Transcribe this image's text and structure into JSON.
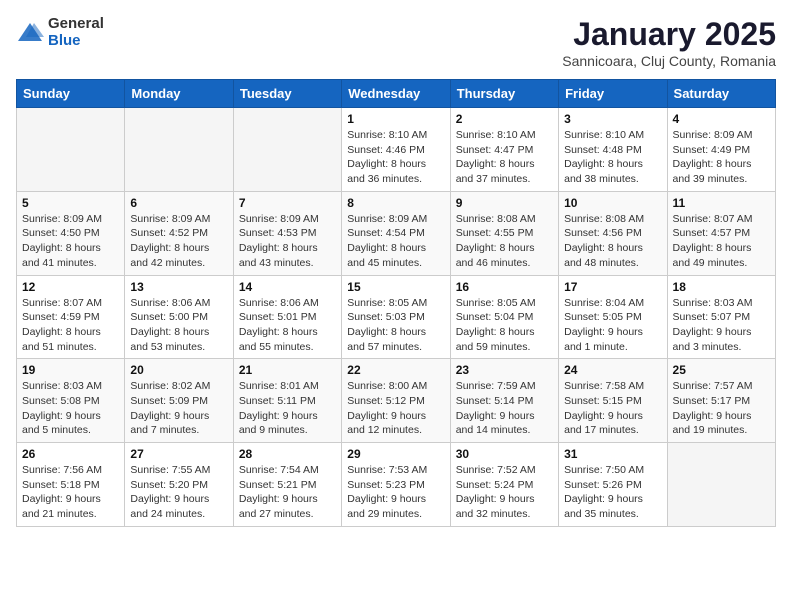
{
  "header": {
    "logo_general": "General",
    "logo_blue": "Blue",
    "title": "January 2025",
    "subtitle": "Sannicoara, Cluj County, Romania"
  },
  "days_of_week": [
    "Sunday",
    "Monday",
    "Tuesday",
    "Wednesday",
    "Thursday",
    "Friday",
    "Saturday"
  ],
  "weeks": [
    [
      {
        "day": "",
        "empty": true
      },
      {
        "day": "",
        "empty": true
      },
      {
        "day": "",
        "empty": true
      },
      {
        "day": "1",
        "sunrise": "8:10 AM",
        "sunset": "4:46 PM",
        "daylight": "8 hours and 36 minutes."
      },
      {
        "day": "2",
        "sunrise": "8:10 AM",
        "sunset": "4:47 PM",
        "daylight": "8 hours and 37 minutes."
      },
      {
        "day": "3",
        "sunrise": "8:10 AM",
        "sunset": "4:48 PM",
        "daylight": "8 hours and 38 minutes."
      },
      {
        "day": "4",
        "sunrise": "8:09 AM",
        "sunset": "4:49 PM",
        "daylight": "8 hours and 39 minutes."
      }
    ],
    [
      {
        "day": "5",
        "sunrise": "8:09 AM",
        "sunset": "4:50 PM",
        "daylight": "8 hours and 41 minutes."
      },
      {
        "day": "6",
        "sunrise": "8:09 AM",
        "sunset": "4:52 PM",
        "daylight": "8 hours and 42 minutes."
      },
      {
        "day": "7",
        "sunrise": "8:09 AM",
        "sunset": "4:53 PM",
        "daylight": "8 hours and 43 minutes."
      },
      {
        "day": "8",
        "sunrise": "8:09 AM",
        "sunset": "4:54 PM",
        "daylight": "8 hours and 45 minutes."
      },
      {
        "day": "9",
        "sunrise": "8:08 AM",
        "sunset": "4:55 PM",
        "daylight": "8 hours and 46 minutes."
      },
      {
        "day": "10",
        "sunrise": "8:08 AM",
        "sunset": "4:56 PM",
        "daylight": "8 hours and 48 minutes."
      },
      {
        "day": "11",
        "sunrise": "8:07 AM",
        "sunset": "4:57 PM",
        "daylight": "8 hours and 49 minutes."
      }
    ],
    [
      {
        "day": "12",
        "sunrise": "8:07 AM",
        "sunset": "4:59 PM",
        "daylight": "8 hours and 51 minutes."
      },
      {
        "day": "13",
        "sunrise": "8:06 AM",
        "sunset": "5:00 PM",
        "daylight": "8 hours and 53 minutes."
      },
      {
        "day": "14",
        "sunrise": "8:06 AM",
        "sunset": "5:01 PM",
        "daylight": "8 hours and 55 minutes."
      },
      {
        "day": "15",
        "sunrise": "8:05 AM",
        "sunset": "5:03 PM",
        "daylight": "8 hours and 57 minutes."
      },
      {
        "day": "16",
        "sunrise": "8:05 AM",
        "sunset": "5:04 PM",
        "daylight": "8 hours and 59 minutes."
      },
      {
        "day": "17",
        "sunrise": "8:04 AM",
        "sunset": "5:05 PM",
        "daylight": "9 hours and 1 minute."
      },
      {
        "day": "18",
        "sunrise": "8:03 AM",
        "sunset": "5:07 PM",
        "daylight": "9 hours and 3 minutes."
      }
    ],
    [
      {
        "day": "19",
        "sunrise": "8:03 AM",
        "sunset": "5:08 PM",
        "daylight": "9 hours and 5 minutes."
      },
      {
        "day": "20",
        "sunrise": "8:02 AM",
        "sunset": "5:09 PM",
        "daylight": "9 hours and 7 minutes."
      },
      {
        "day": "21",
        "sunrise": "8:01 AM",
        "sunset": "5:11 PM",
        "daylight": "9 hours and 9 minutes."
      },
      {
        "day": "22",
        "sunrise": "8:00 AM",
        "sunset": "5:12 PM",
        "daylight": "9 hours and 12 minutes."
      },
      {
        "day": "23",
        "sunrise": "7:59 AM",
        "sunset": "5:14 PM",
        "daylight": "9 hours and 14 minutes."
      },
      {
        "day": "24",
        "sunrise": "7:58 AM",
        "sunset": "5:15 PM",
        "daylight": "9 hours and 17 minutes."
      },
      {
        "day": "25",
        "sunrise": "7:57 AM",
        "sunset": "5:17 PM",
        "daylight": "9 hours and 19 minutes."
      }
    ],
    [
      {
        "day": "26",
        "sunrise": "7:56 AM",
        "sunset": "5:18 PM",
        "daylight": "9 hours and 21 minutes."
      },
      {
        "day": "27",
        "sunrise": "7:55 AM",
        "sunset": "5:20 PM",
        "daylight": "9 hours and 24 minutes."
      },
      {
        "day": "28",
        "sunrise": "7:54 AM",
        "sunset": "5:21 PM",
        "daylight": "9 hours and 27 minutes."
      },
      {
        "day": "29",
        "sunrise": "7:53 AM",
        "sunset": "5:23 PM",
        "daylight": "9 hours and 29 minutes."
      },
      {
        "day": "30",
        "sunrise": "7:52 AM",
        "sunset": "5:24 PM",
        "daylight": "9 hours and 32 minutes."
      },
      {
        "day": "31",
        "sunrise": "7:50 AM",
        "sunset": "5:26 PM",
        "daylight": "9 hours and 35 minutes."
      },
      {
        "day": "",
        "empty": true
      }
    ]
  ]
}
